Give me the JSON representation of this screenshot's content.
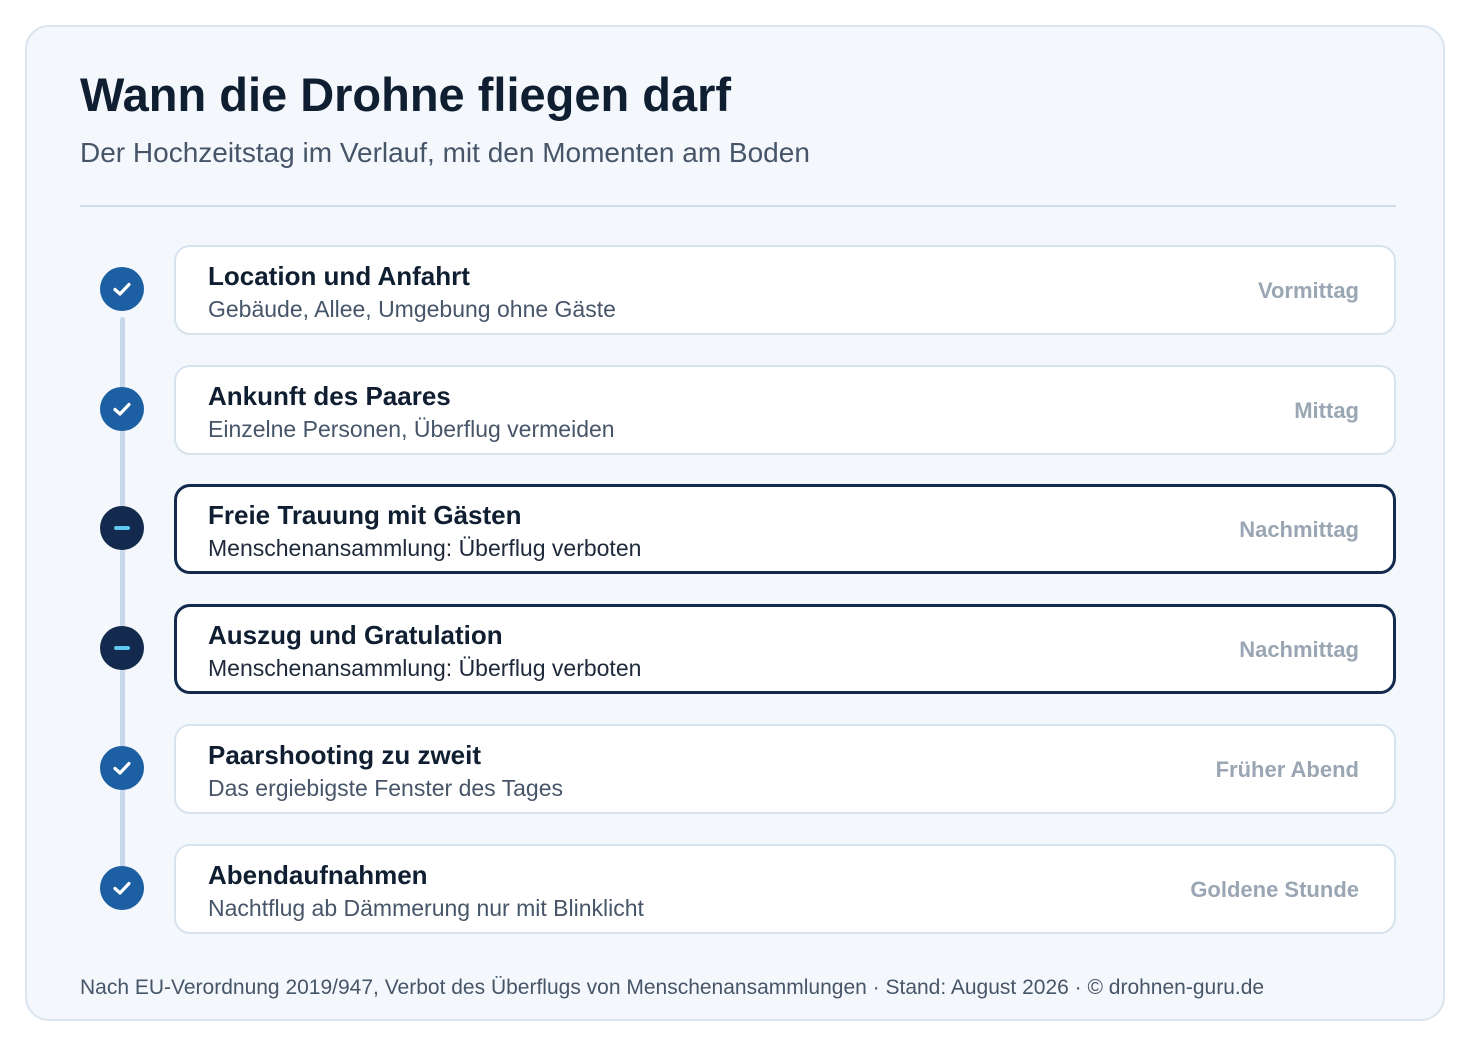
{
  "header": {
    "title": "Wann die Drohne fliegen darf",
    "subtitle": "Der Hochzeitstag im Verlauf, mit den Momenten am Boden"
  },
  "steps": [
    {
      "status": "allowed",
      "icon": "check-icon",
      "title": "Location und Anfahrt",
      "description": "Gebäude, Allee, Umgebung ohne Gäste",
      "time": "Vormittag"
    },
    {
      "status": "allowed",
      "icon": "check-icon",
      "title": "Ankunft des Paares",
      "description": "Einzelne Personen, Überflug vermeiden",
      "time": "Mittag"
    },
    {
      "status": "forbidden",
      "icon": "minus-icon",
      "title": "Freie Trauung mit Gästen",
      "description": "Menschenansammlung: Überflug verboten",
      "time": "Nachmittag"
    },
    {
      "status": "forbidden",
      "icon": "minus-icon",
      "title": "Auszug und Gratulation",
      "description": "Menschenansammlung: Überflug verboten",
      "time": "Nachmittag"
    },
    {
      "status": "allowed",
      "icon": "check-icon",
      "title": "Paarshooting zu zweit",
      "description": "Das ergiebigste Fenster des Tages",
      "time": "Früher Abend"
    },
    {
      "status": "allowed",
      "icon": "check-icon",
      "title": "Abendaufnahmen",
      "description": "Nachtflug ab Dämmerung nur mit Blinklicht",
      "time": "Goldene Stunde"
    }
  ],
  "footer": {
    "text": "Nach EU-Verordnung 2019/947, Verbot des Überflugs von Menschenansammlungen · Stand: August 2026 · © drohnen-guru.de"
  },
  "colors": {
    "allowed_marker": "#1d5fa3",
    "forbidden_marker": "#13294d",
    "forbidden_dash": "#5ec8f2",
    "card_background": "#f4f8fc"
  }
}
